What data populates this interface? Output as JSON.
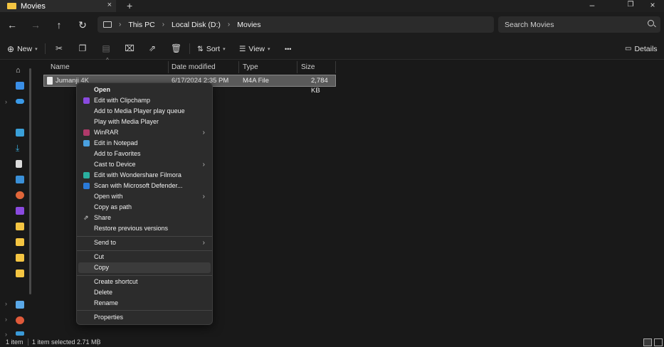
{
  "window": {
    "tab_title": "Movies",
    "tab_close": "×",
    "new_tab": "+",
    "controls": [
      "–",
      "❐",
      "×"
    ]
  },
  "nav": {
    "back": "←",
    "forward": "→",
    "up": "↑",
    "refresh": "↻"
  },
  "breadcrumb": [
    "This PC",
    "Local Disk (D:)",
    "Movies"
  ],
  "breadcrumb_sep": "›",
  "search": {
    "placeholder": "Search Movies"
  },
  "toolbar": {
    "new_label": "New",
    "sort_label": "Sort",
    "view_label": "View",
    "more_label": "•••",
    "details_label": "Details"
  },
  "columns": [
    "Name",
    "Date modified",
    "Type",
    "Size"
  ],
  "files": [
    {
      "name": "Jumanji 4K",
      "date": "6/17/2024 2:35 PM",
      "type": "M4A File",
      "size": "2,784 KB"
    }
  ],
  "context_menu": {
    "items": [
      {
        "label": "Open",
        "bold": true,
        "icon": "",
        "submenu": false
      },
      {
        "label": "Edit with Clipchamp",
        "icon": "clipchamp-icon",
        "submenu": false
      },
      {
        "label": "Add to Media Player play queue",
        "icon": "",
        "submenu": false
      },
      {
        "label": "Play with Media Player",
        "icon": "",
        "submenu": false
      },
      {
        "label": "WinRAR",
        "icon": "winrar-icon",
        "submenu": true
      },
      {
        "label": "Edit in Notepad",
        "icon": "notepad-icon",
        "submenu": false
      },
      {
        "label": "Add to Favorites",
        "icon": "",
        "submenu": false
      },
      {
        "label": "Cast to Device",
        "icon": "",
        "submenu": true
      },
      {
        "label": "Edit with Wondershare Filmora",
        "icon": "filmora-icon",
        "submenu": false
      },
      {
        "label": "Scan with Microsoft Defender...",
        "icon": "defender-icon",
        "submenu": false
      },
      {
        "label": "Open with",
        "icon": "",
        "submenu": true
      },
      {
        "label": "Copy as path",
        "icon": "",
        "submenu": false
      },
      {
        "label": "Share",
        "icon": "share-icon",
        "submenu": false
      },
      {
        "label": "Restore previous versions",
        "icon": "",
        "submenu": false
      },
      {
        "label": "Send to",
        "icon": "",
        "submenu": true
      },
      {
        "label": "Cut",
        "icon": "",
        "submenu": false
      },
      {
        "label": "Copy",
        "icon": "",
        "submenu": false,
        "hovered": true
      },
      {
        "label": "Create shortcut",
        "icon": "",
        "submenu": false
      },
      {
        "label": "Delete",
        "icon": "",
        "submenu": false
      },
      {
        "label": "Rename",
        "icon": "",
        "submenu": false
      },
      {
        "label": "Properties",
        "icon": "",
        "submenu": false
      }
    ],
    "submenu_arrow": "›"
  },
  "status": {
    "item_count": "1 item",
    "selection": "1 item selected  2.71 MB"
  },
  "colors": {
    "background": "#191919",
    "menu_bg": "#2c2c2c",
    "folder": "#f4c542",
    "selection": "#5a5a5a"
  }
}
